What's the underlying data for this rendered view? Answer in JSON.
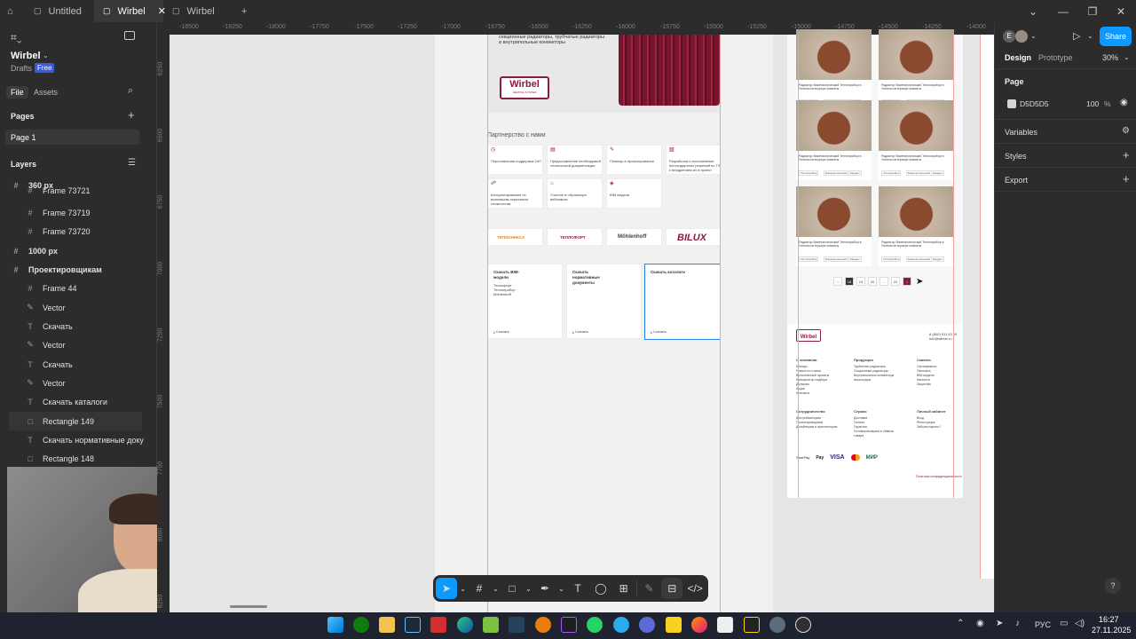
{
  "titlebar": {
    "tabs": [
      {
        "label": "Untitled"
      },
      {
        "label": "Wirbel"
      },
      {
        "label": "Wirbel"
      }
    ]
  },
  "left": {
    "file_name": "Wirbel",
    "drafts": "Drafts",
    "plan": "Free",
    "tab_file": "File",
    "tab_assets": "Assets",
    "pages_title": "Pages",
    "page1": "Page 1",
    "layers_title": "Layers",
    "layers": [
      {
        "name": "360 px",
        "icon": "#"
      },
      {
        "name": "Frame 73721",
        "icon": "#"
      },
      {
        "name": "Frame 73719",
        "icon": "#"
      },
      {
        "name": "Frame 73720",
        "icon": "#"
      },
      {
        "name": "1000 px",
        "icon": "#"
      },
      {
        "name": "Проектировщикам",
        "icon": "#"
      },
      {
        "name": "Frame 44",
        "icon": "#"
      },
      {
        "name": "Vector",
        "icon": "✎"
      },
      {
        "name": "Скачать",
        "icon": "T"
      },
      {
        "name": "Vector",
        "icon": "✎"
      },
      {
        "name": "Скачать",
        "icon": "T"
      },
      {
        "name": "Vector",
        "icon": "✎"
      },
      {
        "name": "Скачать каталоги",
        "icon": "T"
      },
      {
        "name": "Rectangle 149",
        "icon": "□"
      },
      {
        "name": "Скачать нормативные документ",
        "icon": "T"
      },
      {
        "name": "Rectangle 148",
        "icon": "□"
      }
    ]
  },
  "ruler": {
    "ticks": [
      "-18500",
      "-18250",
      "-18000",
      "-17750",
      "-17500",
      "-17250",
      "-17000",
      "-16750",
      "-16500",
      "-16250",
      "-16000",
      "-15750",
      "-15500",
      "-15250",
      "-15000",
      "-14750",
      "-14500",
      "-14250",
      "-14000"
    ],
    "vticks": [
      "6250",
      "6500",
      "6750",
      "7000",
      "7250",
      "7500",
      "7750",
      "8000",
      "8250"
    ]
  },
  "design": {
    "intro_text": "секционные радиаторы, трубчатые радиаторы и внутрипольные конвекторы",
    "logo": "Wirbel",
    "logo_sub": "HEATING SYSTEM",
    "partnership_title": "Партнерство с нами",
    "features": [
      "Персональная поддержка 24/7",
      "Предоставление необходимой технической документации",
      "Помощь в проектировании",
      "Разработка и изготовление нестандартных решений по ТЗ с внедрением их в проект",
      "Консультирование по возникшим серьезным сложностям",
      "Участие в обучающих вебинарах",
      "BIM модели"
    ],
    "brands": [
      "ТЕПЛОНИКСА",
      "ТЕПЛОФОРТ",
      "Möhlenhoff",
      "BILUX"
    ],
    "downloads": [
      {
        "title": "Скачать BIM-модели",
        "items": "Теплофорт\nТеплоприбор\nMöhlenhoff",
        "link": "Скачать"
      },
      {
        "title": "Скачать нормативные документы",
        "items": "",
        "link": "Скачать"
      },
      {
        "title": "Скачать каталоги",
        "items": "",
        "link": "Скачать"
      }
    ],
    "product_title": "Радиатор биметаллический Теплоприбор в Уютном интерьере комнаты",
    "tags": [
      "Теплоприбор",
      "Биметаллический",
      "Модерн"
    ],
    "pagination": [
      "‹",
      "18",
      "19",
      "20",
      "...",
      "22",
      "›"
    ],
    "footer": {
      "phone": "8 (800) 511 53 99",
      "email": "info@wirbel.ru",
      "col1_title": "О компании",
      "col1": [
        "Бренды",
        "Новости и статьи",
        "Выполненные проекты",
        "Калькулятор подбора",
        "Дилерам",
        "Акции",
        "Контакты"
      ],
      "col2_title": "Продукция",
      "col2": [
        "Трубчатые радиаторы",
        "Секционные радиаторы",
        "Внутрипольные конвекторы",
        "Аксессуары"
      ],
      "col3_title": "Скачать",
      "col3": [
        "Сертификаты",
        "Паспорта",
        "BIM-модели",
        "Каталоги",
        "Лицензии"
      ],
      "col4_title": "Сотрудничество",
      "col4": [
        "Дистрибьюторам",
        "Проектировщикам",
        "Дизайнерам и архитекторам"
      ],
      "col5_title": "Сервис",
      "col5": [
        "Доставка",
        "Оплата",
        "Гарантия",
        "Условия возврата и обмена товара"
      ],
      "col6_title": "Личный кабинет",
      "col6": [
        "Вход",
        "Регистрация",
        "Забыли пароль?"
      ],
      "payments": [
        "SberPay",
        "Pay",
        "VISA",
        "MC",
        "МИР"
      ],
      "legal": "Политика конфиденциальности"
    }
  },
  "right": {
    "avatar_letter": "E",
    "share": "Share",
    "tab_design": "Design",
    "tab_prototype": "Prototype",
    "zoom": "30%",
    "page_title": "Page",
    "page_color": "D5D5D5",
    "page_opacity": "100",
    "page_opacity_unit": "%",
    "variables": "Variables",
    "styles": "Styles",
    "export": "Export",
    "help": "?"
  },
  "taskbar": {
    "lang": "РУС",
    "time": "16:27",
    "date": "27.11.2025"
  },
  "colors": {
    "accent": "#0d99ff",
    "brand": "#8b1c3c",
    "selection": "#2b7de9"
  }
}
